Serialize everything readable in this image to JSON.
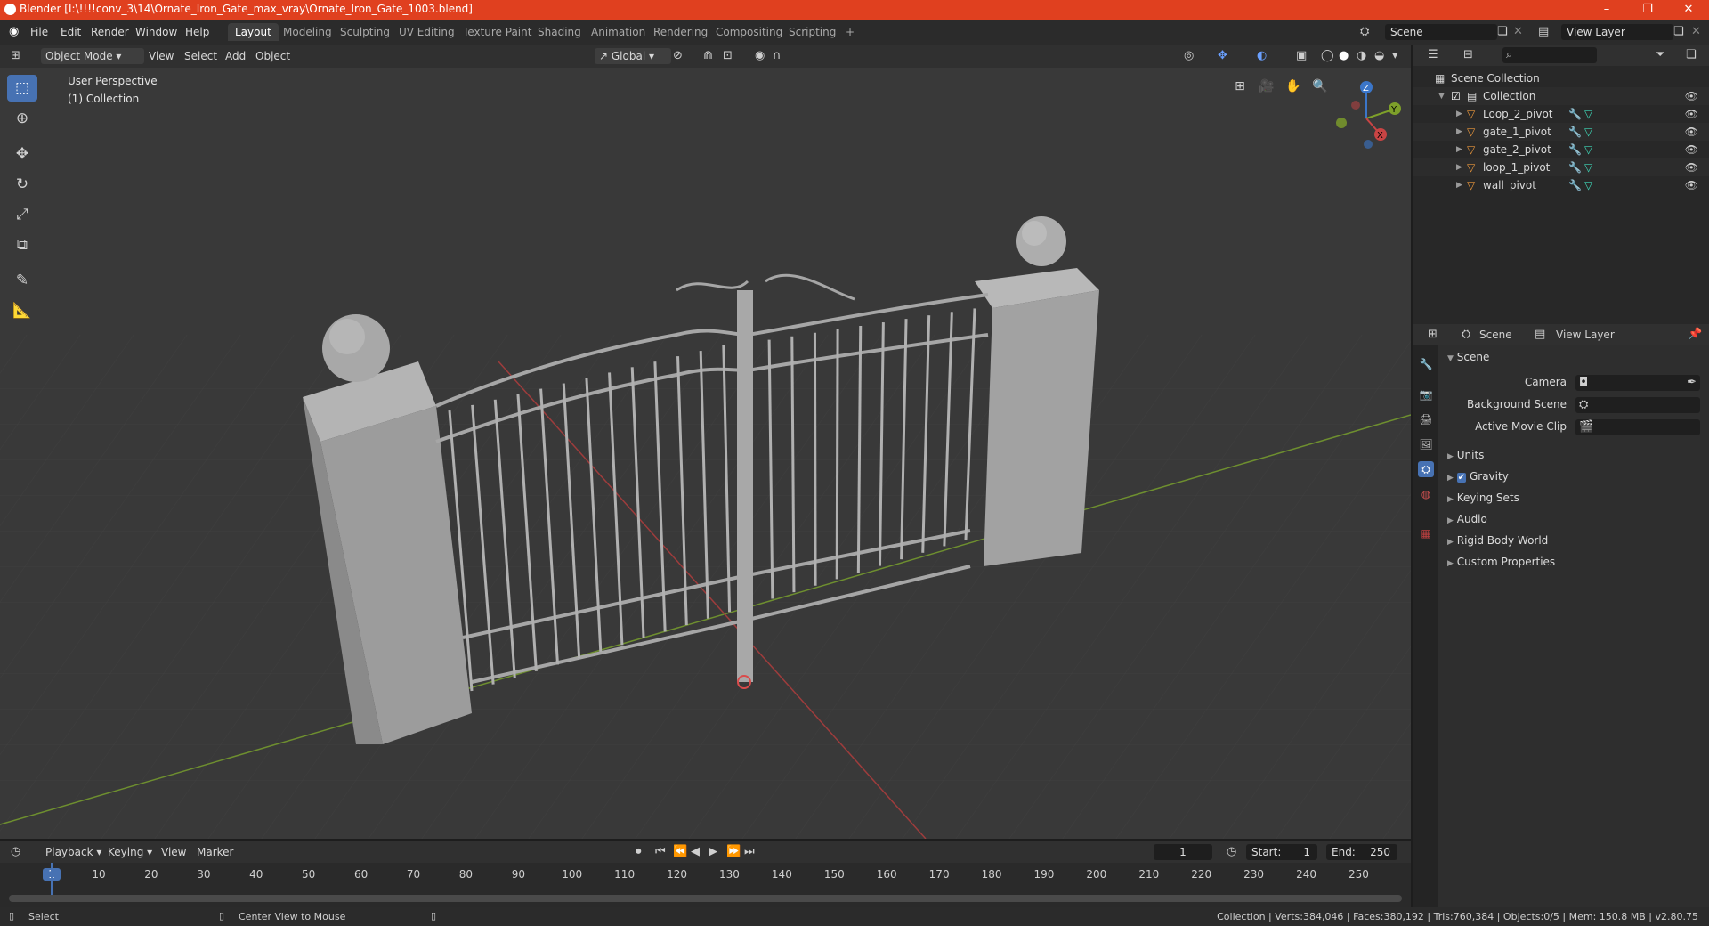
{
  "window": {
    "title": "Blender [I:\\!!!!conv_3\\14\\Ornate_Iron_Gate_max_vray\\Ornate_Iron_Gate_1003.blend]",
    "minimize": "–",
    "maximize": "❐",
    "close": "✕"
  },
  "menu": [
    "File",
    "Edit",
    "Render",
    "Window",
    "Help"
  ],
  "workspaces": [
    "Layout",
    "Modeling",
    "Sculpting",
    "UV Editing",
    "Texture Paint",
    "Shading",
    "Animation",
    "Rendering",
    "Compositing",
    "Scripting"
  ],
  "workspace_add": "+",
  "scene_field": "Scene",
  "view_layer_field": "View Layer",
  "viewport_header": {
    "mode": "Object Mode",
    "menus": [
      "View",
      "Select",
      "Add",
      "Object"
    ],
    "orientation": "Global"
  },
  "viewport": {
    "perspective": "User Perspective",
    "collection": "(1) Collection",
    "gizmo": {
      "z": "Z",
      "y": "Y",
      "x": "X"
    }
  },
  "outliner": {
    "search_placeholder": "",
    "root": "Scene Collection",
    "collection": "Collection",
    "items": [
      "Loop_2_pivot",
      "gate_1_pivot",
      "gate_2_pivot",
      "loop_1_pivot",
      "wall_pivot"
    ]
  },
  "properties": {
    "header_scene": "Scene",
    "header_view_layer": "View Layer",
    "panel_title": "Scene",
    "camera_label": "Camera",
    "background_scene_label": "Background Scene",
    "active_movie_clip_label": "Active Movie Clip",
    "sections": [
      "Units",
      "Gravity",
      "Keying Sets",
      "Audio",
      "Rigid Body World",
      "Custom Properties"
    ]
  },
  "timeline": {
    "menus": [
      "Playback",
      "Keying",
      "View",
      "Marker"
    ],
    "current_frame": "1",
    "start_label": "Start:",
    "start": "1",
    "end_label": "End:",
    "end": "250",
    "ruler": [
      "1",
      "10",
      "20",
      "30",
      "40",
      "50",
      "60",
      "70",
      "80",
      "90",
      "100",
      "110",
      "120",
      "130",
      "140",
      "150",
      "160",
      "170",
      "180",
      "190",
      "200",
      "210",
      "220",
      "230",
      "240",
      "250"
    ]
  },
  "status": {
    "left1": "Select",
    "left2": "Center View to Mouse",
    "right": "Collection | Verts:384,046 | Faces:380,192 | Tris:760,384 | Objects:0/5 | Mem: 150.8 MB | v2.80.75"
  },
  "colors": {
    "title_bar": "#e0401f",
    "active_tool": "#4772b3",
    "viewport_bg": "#393939"
  }
}
